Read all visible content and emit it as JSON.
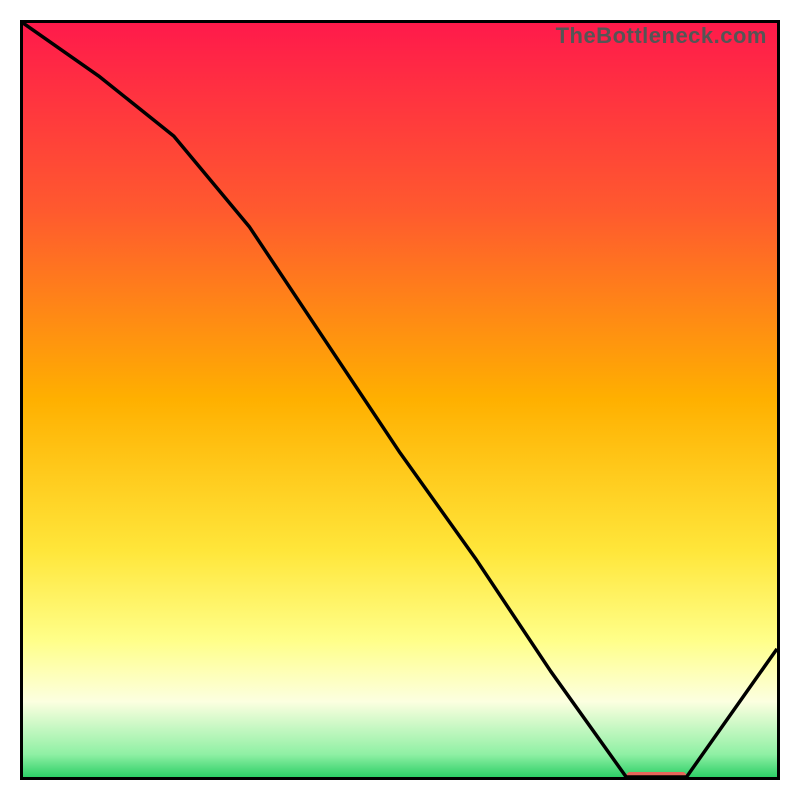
{
  "watermark": "TheBottleneck.com",
  "chart_data": {
    "type": "line",
    "title": "",
    "xlabel": "",
    "ylabel": "",
    "xlim": [
      0,
      100
    ],
    "ylim": [
      0,
      100
    ],
    "series": [
      {
        "name": "curve",
        "x": [
          0,
          10,
          20,
          30,
          40,
          50,
          60,
          70,
          80,
          88,
          100
        ],
        "y": [
          100,
          93,
          85,
          73,
          58,
          43,
          29,
          14,
          0,
          0,
          17
        ]
      }
    ],
    "marker": {
      "name": "highlight-segment",
      "x_start": 80,
      "x_end": 88,
      "y": 0,
      "color": "#e7665b"
    },
    "gradient_stops": [
      {
        "offset": 0.0,
        "color": "#ff1a4b"
      },
      {
        "offset": 0.25,
        "color": "#ff5a2e"
      },
      {
        "offset": 0.5,
        "color": "#ffb000"
      },
      {
        "offset": 0.7,
        "color": "#ffe63a"
      },
      {
        "offset": 0.82,
        "color": "#ffff8a"
      },
      {
        "offset": 0.9,
        "color": "#fcffe0"
      },
      {
        "offset": 0.97,
        "color": "#8ff0a4"
      },
      {
        "offset": 1.0,
        "color": "#2ecf67"
      }
    ]
  }
}
